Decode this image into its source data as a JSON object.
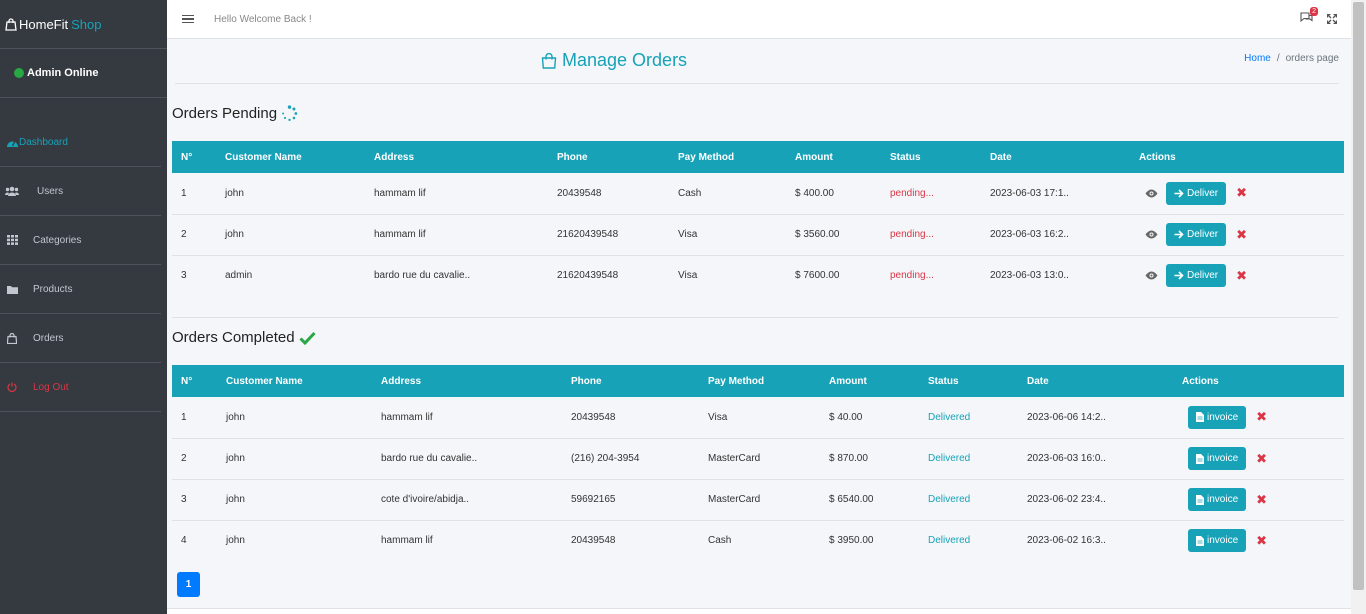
{
  "sidebar": {
    "brand_main": "HomeFit",
    "brand_accent": "Shop",
    "status": "Admin Online",
    "items": [
      {
        "label": "Dashboard",
        "icon": "tachometer-icon"
      },
      {
        "label": "Users",
        "icon": "users-icon"
      },
      {
        "label": "Categories",
        "icon": "grid-icon"
      },
      {
        "label": "Products",
        "icon": "folder-icon"
      },
      {
        "label": "Orders",
        "icon": "shopping-bag-icon"
      },
      {
        "label": "Log Out",
        "icon": "power-icon"
      }
    ]
  },
  "topbar": {
    "welcome": "Hello Welcome Back !",
    "notification_count": "2"
  },
  "header": {
    "title": "Manage Orders",
    "breadcrumb_home": "Home",
    "breadcrumb_sep": "/",
    "breadcrumb_current": "orders page"
  },
  "pending": {
    "title": "Orders Pending",
    "columns": [
      "N°",
      "Customer Name",
      "Address",
      "Phone",
      "Pay Method",
      "Amount",
      "Status",
      "Date",
      "Actions"
    ],
    "rows": [
      {
        "n": "1",
        "name": "john",
        "address": "hammam lif",
        "phone": "20439548",
        "pay": "Cash",
        "amount": "$ 400.00",
        "status": "pending...",
        "date": "2023-06-03 17:1.."
      },
      {
        "n": "2",
        "name": "john",
        "address": "hammam lif",
        "phone": "21620439548",
        "pay": "Visa",
        "amount": "$ 3560.00",
        "status": "pending...",
        "date": "2023-06-03 16:2.."
      },
      {
        "n": "3",
        "name": "admin",
        "address": "bardo rue du cavalie..",
        "phone": "21620439548",
        "pay": "Visa",
        "amount": "$ 7600.00",
        "status": "pending...",
        "date": "2023-06-03 13:0.."
      }
    ],
    "deliver_label": "Deliver"
  },
  "completed": {
    "title": "Orders Completed",
    "columns": [
      "N°",
      "Customer Name",
      "Address",
      "Phone",
      "Pay Method",
      "Amount",
      "Status",
      "Date",
      "Actions"
    ],
    "rows": [
      {
        "n": "1",
        "name": "john",
        "address": "hammam lif",
        "phone": "20439548",
        "pay": "Visa",
        "amount": "$ 40.00",
        "status": "Delivered",
        "date": "2023-06-06 14:2.."
      },
      {
        "n": "2",
        "name": "john",
        "address": "bardo rue du cavalie..",
        "phone": "(216) 204-3954",
        "pay": "MasterCard",
        "amount": "$ 870.00",
        "status": "Delivered",
        "date": "2023-06-03 16:0.."
      },
      {
        "n": "3",
        "name": "john",
        "address": "cote d'ivoire/abidja..",
        "phone": "59692165",
        "pay": "MasterCard",
        "amount": "$ 6540.00",
        "status": "Delivered",
        "date": "2023-06-02 23:4.."
      },
      {
        "n": "4",
        "name": "john",
        "address": "hammam lif",
        "phone": "20439548",
        "pay": "Cash",
        "amount": "$ 3950.00",
        "status": "Delivered",
        "date": "2023-06-02 16:3.."
      }
    ],
    "invoice_label": "invoice"
  },
  "pagination": {
    "current": "1"
  },
  "colors": {
    "accent": "#17a2b8",
    "sidebar": "#343a40",
    "danger": "#dc3545",
    "success": "#28a745",
    "primary": "#007bff"
  }
}
